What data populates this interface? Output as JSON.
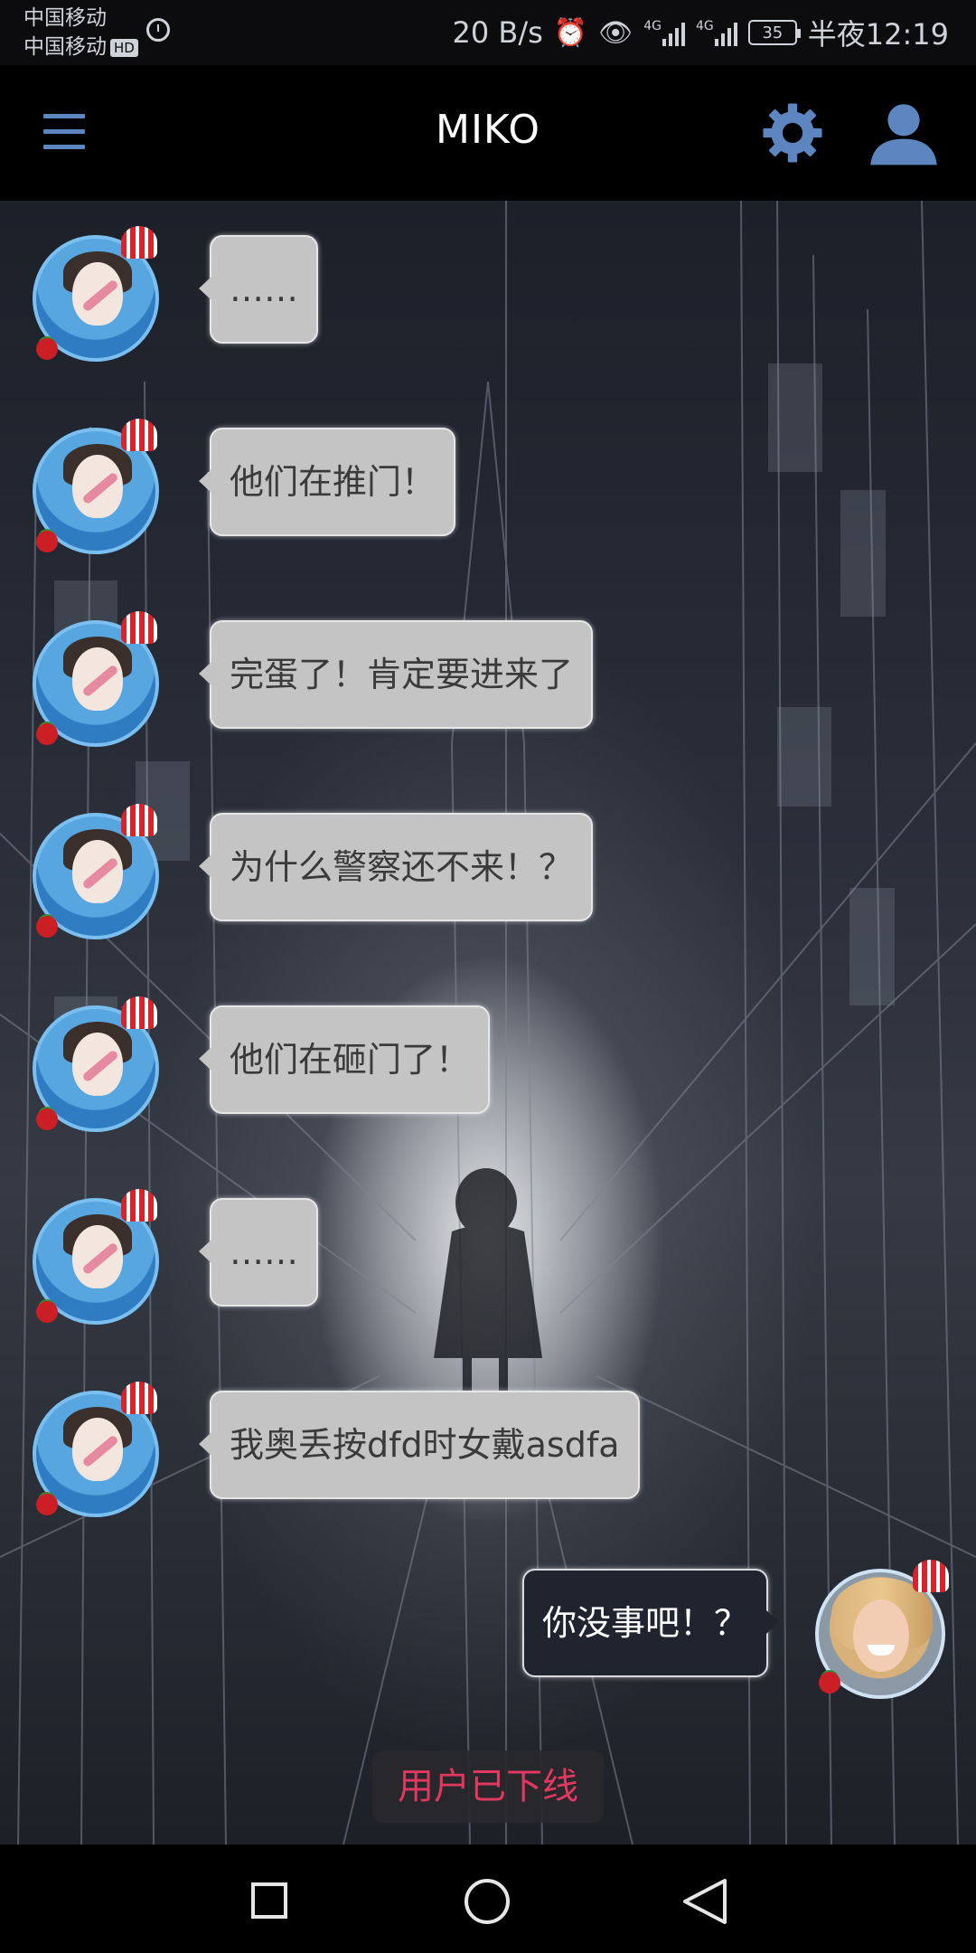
{
  "status_bar": {
    "carrier_1": "中国移动",
    "carrier_2": "中国移动",
    "hd_badge": "HD",
    "net_speed": "20 B/s",
    "signal_1_label": "4G",
    "signal_2_label": "4G",
    "battery": "35",
    "time": "半夜12:19",
    "icons": [
      "stopwatch-icon",
      "alarm-icon",
      "eye-icon",
      "signal-icon",
      "battery-icon"
    ]
  },
  "app_bar": {
    "title": "MIKO",
    "icons": [
      "menu-icon",
      "gear-icon",
      "user-icon"
    ],
    "accent_color": "#5d86c0"
  },
  "messages": [
    {
      "from": "them",
      "text": "……"
    },
    {
      "from": "them",
      "text": "他们在推门！"
    },
    {
      "from": "them",
      "text": "完蛋了！肯定要进来了"
    },
    {
      "from": "them",
      "text": "为什么警察还不来！？"
    },
    {
      "from": "them",
      "text": "他们在砸门了！"
    },
    {
      "from": "them",
      "text": "……"
    },
    {
      "from": "them",
      "text": "我奥丢按dfd时女戴asdfa"
    },
    {
      "from": "me",
      "text": "你没事吧！？"
    }
  ],
  "offline_notice": "用户已下线",
  "nav_bar": {
    "icons": [
      "recent-apps-icon",
      "home-icon",
      "back-icon"
    ]
  }
}
